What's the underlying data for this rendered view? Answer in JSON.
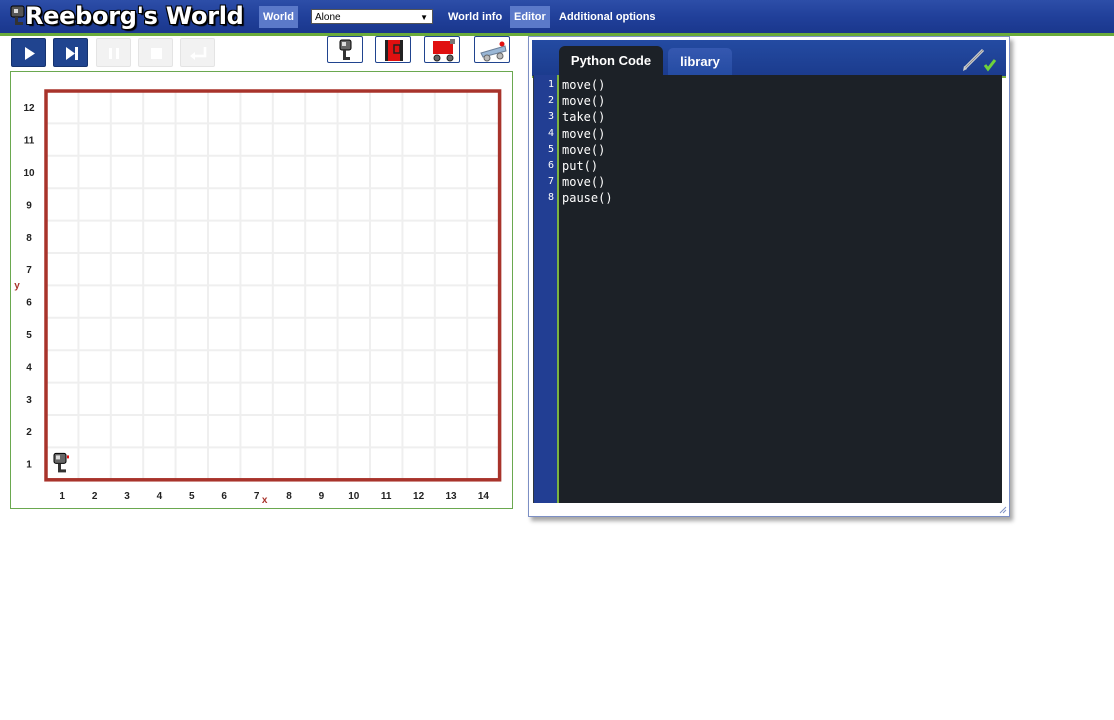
{
  "header": {
    "title": "Reeborg's World",
    "menu": {
      "world": "World",
      "world_info": "World info",
      "editor": "Editor",
      "additional_options": "Additional options"
    },
    "world_select": {
      "selected": "Alone"
    }
  },
  "controls": {
    "buttons": [
      {
        "name": "run",
        "icon": "play-icon",
        "enabled": true
      },
      {
        "name": "step",
        "icon": "step-icon",
        "enabled": true
      },
      {
        "name": "pause",
        "icon": "pause-icon",
        "enabled": false
      },
      {
        "name": "stop",
        "icon": "stop-icon",
        "enabled": false
      },
      {
        "name": "reload",
        "icon": "return-icon",
        "enabled": false
      }
    ],
    "tools": [
      "robot-icon",
      "edit-world-icon",
      "red-robot-icon",
      "drawing-icon"
    ]
  },
  "world": {
    "x_axis_label": "x",
    "y_axis_label": "y",
    "cols": 14,
    "rows": 12,
    "x_ticks": [
      "1",
      "2",
      "3",
      "4",
      "5",
      "6",
      "7",
      "8",
      "9",
      "10",
      "11",
      "12",
      "13",
      "14"
    ],
    "y_ticks": [
      "1",
      "2",
      "3",
      "4",
      "5",
      "6",
      "7",
      "8",
      "9",
      "10",
      "11",
      "12"
    ],
    "robot": {
      "x": 1,
      "y": 1,
      "facing": "east"
    },
    "colors": {
      "wall": "#a8332b",
      "grid": "#efefef",
      "frame": "#6aa84f"
    }
  },
  "editor": {
    "tabs": [
      "Python Code",
      "library"
    ],
    "active_tab": "Python Code",
    "line_numbers": [
      "1",
      "2",
      "3",
      "4",
      "5",
      "6",
      "7",
      "8"
    ],
    "code_lines": [
      "move()",
      "move()",
      "take()",
      "move()",
      "move()",
      "put()",
      "move()",
      "pause()"
    ]
  },
  "colors": {
    "header": "#21409a",
    "accent": "#6aab3a",
    "editor_bg": "#1c2127",
    "gutter": "#223e93"
  }
}
